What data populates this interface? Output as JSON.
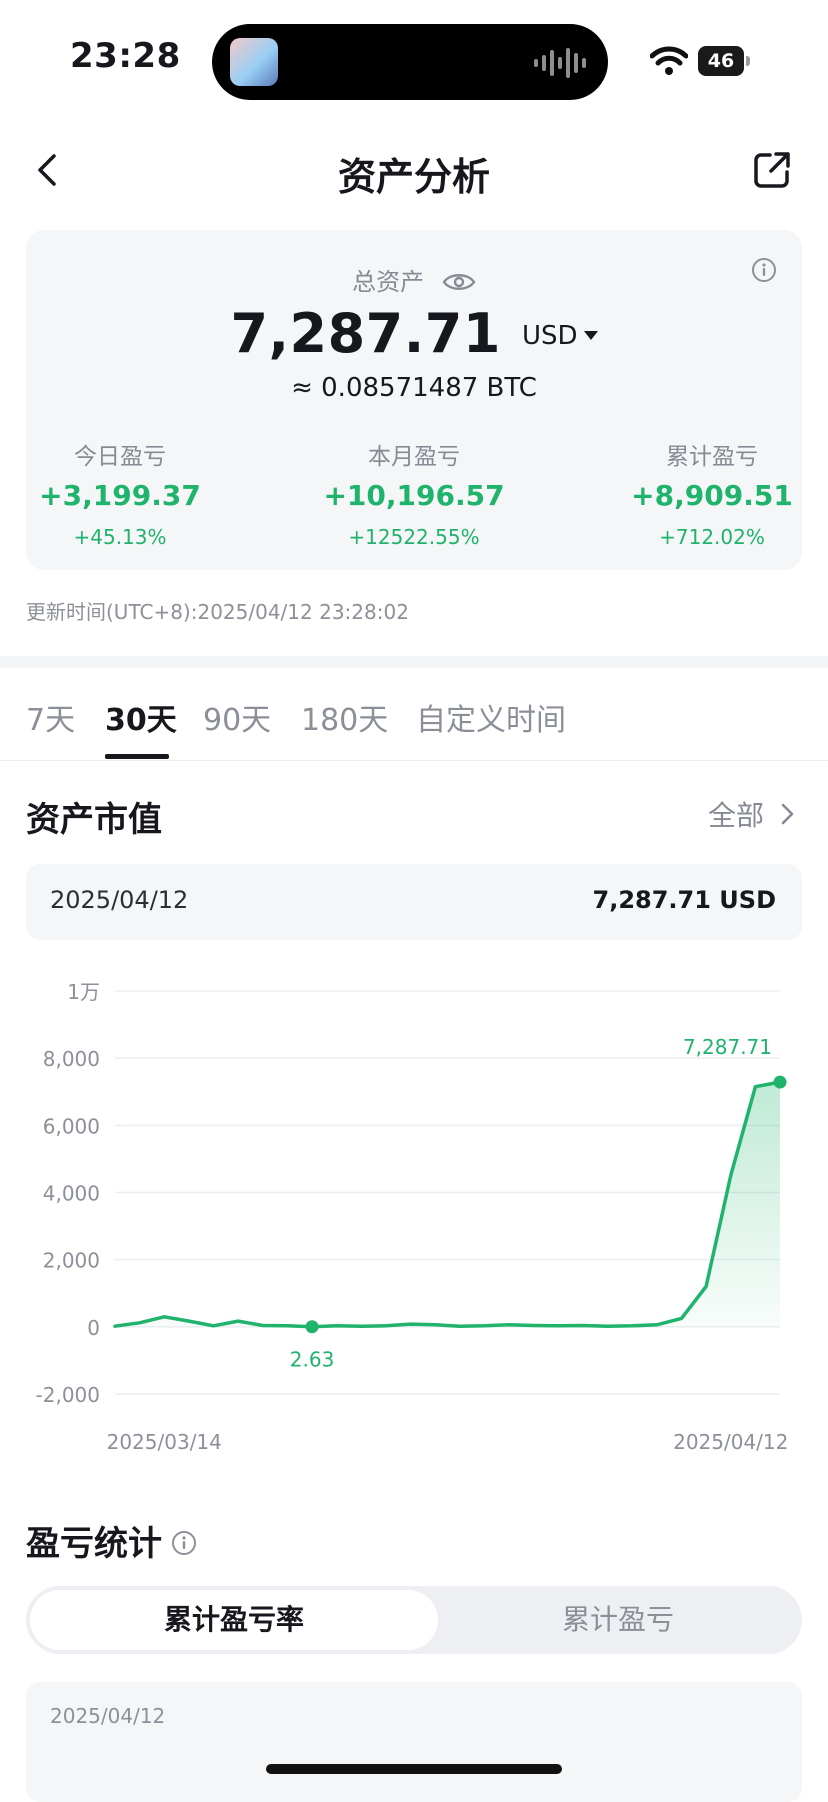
{
  "status_bar": {
    "time": "23:28",
    "battery": "46"
  },
  "header": {
    "title": "资产分析"
  },
  "summary": {
    "label": "总资产",
    "total": "7,287.71",
    "currency": "USD",
    "btc_equivalent": "≈ 0.08571487 BTC",
    "stats": [
      {
        "label": "今日盈亏",
        "value": "+3,199.37",
        "pct": "+45.13%"
      },
      {
        "label": "本月盈亏",
        "value": "+10,196.57",
        "pct": "+12522.55%"
      },
      {
        "label": "累计盈亏",
        "value": "+8,909.51",
        "pct": "+712.02%"
      }
    ],
    "update_time": "更新时间(UTC+8):2025/04/12 23:28:02"
  },
  "tabs": [
    {
      "label": "7天",
      "active": false
    },
    {
      "label": "30天",
      "active": true
    },
    {
      "label": "90天",
      "active": false
    },
    {
      "label": "180天",
      "active": false
    },
    {
      "label": "自定义时间",
      "active": false
    }
  ],
  "market_value": {
    "title": "资产市值",
    "all_label": "全部",
    "selected_date": "2025/04/12",
    "selected_value": "7,287.71 USD"
  },
  "colors": {
    "accent_green": "#1fb36c",
    "text_primary": "#16181d",
    "text_muted": "#858a93",
    "card_bg": "#f5f6f8"
  },
  "chart_data": {
    "type": "area",
    "y_tick_labels": [
      "1万",
      "8,000",
      "6,000",
      "4,000",
      "2,000",
      "0",
      "-2,000"
    ],
    "y_ticks": [
      10000,
      8000,
      6000,
      4000,
      2000,
      0,
      -2000
    ],
    "ylim": [
      -2000,
      10000
    ],
    "x_tick_labels": [
      "2025/03/14",
      "2025/04/12"
    ],
    "x_label_indices": [
      2,
      25
    ],
    "values": [
      20,
      120,
      300,
      170,
      30,
      170,
      40,
      30,
      2.63,
      30,
      20,
      30,
      80,
      60,
      20,
      30,
      60,
      40,
      30,
      40,
      20,
      30,
      60,
      250,
      1200,
      4500,
      7150,
      7287.71
    ],
    "min_index": 8,
    "min_label": "2.63",
    "max_index": 27,
    "max_label": "7,287.71",
    "grid": true
  },
  "pnl": {
    "title": "盈亏统计",
    "segments": [
      "累计盈亏率",
      "累计盈亏"
    ],
    "date": "2025/04/12"
  }
}
